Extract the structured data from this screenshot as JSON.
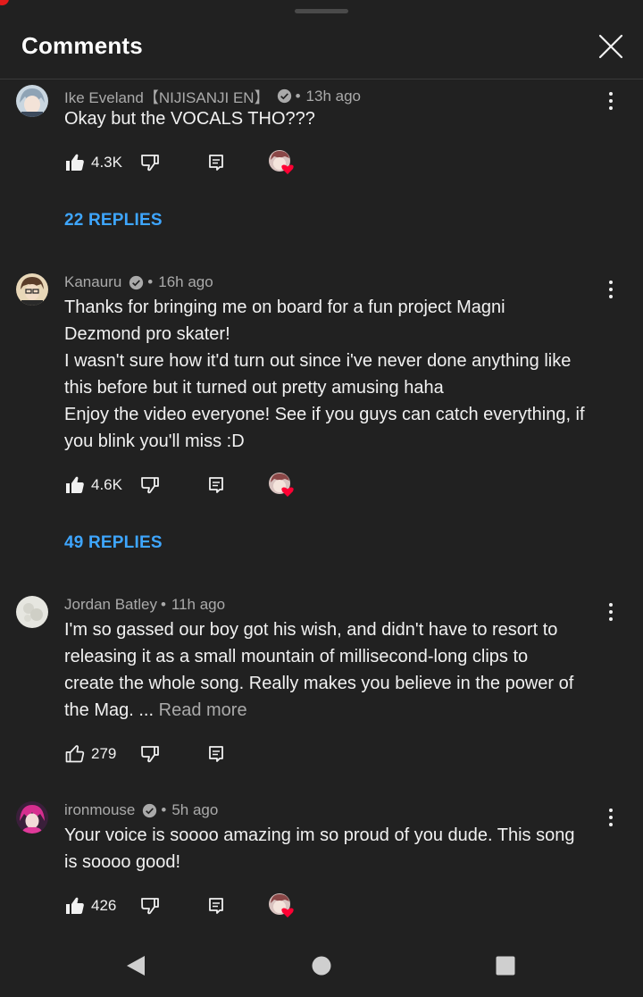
{
  "header": {
    "title": "Comments"
  },
  "comments": [
    {
      "author": "Ike Eveland【NIJISANJI EN】",
      "verified": true,
      "separator": "•",
      "time": "13h ago",
      "text": [
        "Okay but the VOCALS THO???"
      ],
      "likes": "4.3K",
      "liked_filled": true,
      "creator_heart": true,
      "replies_label": "22 REPLIES"
    },
    {
      "author": "Kanauru",
      "verified": true,
      "separator": "•",
      "time": "16h ago",
      "text": [
        "Thanks for bringing me on board for a fun project Magni",
        "Dezmond pro skater!",
        "I wasn't sure how it'd turn out since i've never done anything like",
        "this before but it turned out pretty amusing haha",
        "Enjoy the video everyone! See if you guys can catch everything, if",
        "you blink you'll miss :D"
      ],
      "likes": "4.6K",
      "liked_filled": true,
      "creator_heart": true,
      "replies_label": "49 REPLIES"
    },
    {
      "author": "Jordan Batley",
      "verified": false,
      "separator": "•",
      "time": "11h ago",
      "text": [
        "I'm so gassed our boy got his wish, and didn't have to resort to",
        "releasing it as a small mountain of millisecond-long clips to",
        "create the whole song. Really makes you believe in the power of",
        "the Mag. ..."
      ],
      "read_more": "Read more",
      "likes": "279",
      "liked_filled": false,
      "creator_heart": false
    },
    {
      "author": "ironmouse",
      "verified": true,
      "separator": "•",
      "time": "5h ago",
      "text": [
        "Your voice is soooo amazing im so proud of you dude. This song",
        "is soooo good!"
      ],
      "likes": "426",
      "liked_filled": true,
      "creator_heart": true
    }
  ],
  "icons": {
    "close": "close-icon",
    "verified": "verified-check-icon",
    "like": "thumbs-up-icon",
    "dislike": "thumbs-down-icon",
    "reply": "reply-icon",
    "menu": "more-vert-icon",
    "heart": "creator-heart-icon",
    "nav_back": "nav-back-icon",
    "nav_home": "nav-home-icon",
    "nav_recents": "nav-recents-icon"
  },
  "colors": {
    "background": "#212121",
    "link_blue": "#3ea6ff",
    "heart_red": "#ff0033",
    "text_primary": "#f1f1f1",
    "text_secondary": "#aaaaaa"
  }
}
